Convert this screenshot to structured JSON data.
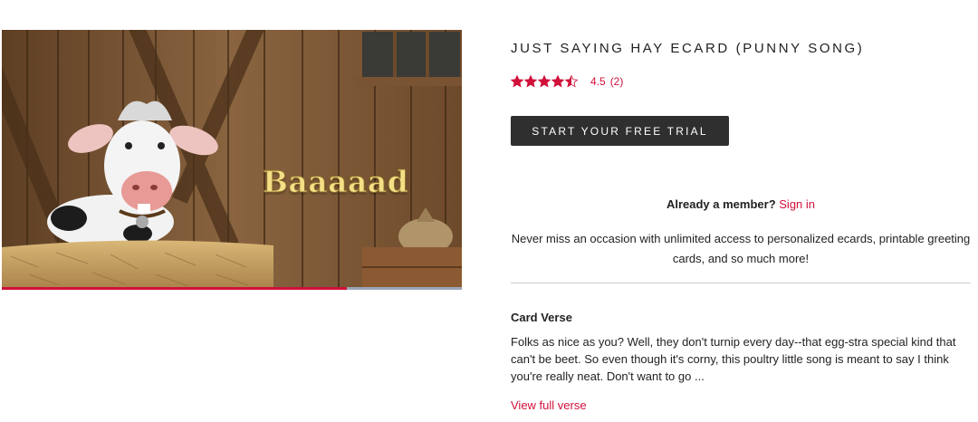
{
  "video": {
    "caption": "Baaaaad",
    "progress": 0.75,
    "colors": {
      "progress_fill": "#d0103a",
      "progress_track": "#9aa6b8"
    }
  },
  "product": {
    "title": "JUST SAYING HAY ECARD (PUNNY SONG)",
    "rating": {
      "stars": 4.5,
      "value_text": "4.5",
      "count_text": "(2)",
      "icon": "star-icon",
      "color": "#d0103a"
    },
    "cta_label": "START YOUR FREE TRIAL"
  },
  "membership": {
    "question": "Already a member?",
    "signin_label": "Sign in",
    "promo": "Never miss an occasion with unlimited access to personalized ecards, printable greeting cards, and so much more!"
  },
  "verse": {
    "heading": "Card Verse",
    "text": "Folks as nice as you? Well, they don't turnip every day--that egg-stra special kind that can't be beet. So even though it's corny, this poultry little song is meant to say I think you're really neat. Don't want to go ...",
    "link_label": "View full verse"
  },
  "colors": {
    "accent": "#d0103a",
    "button_bg": "#2f2f2f",
    "text": "#222222"
  }
}
